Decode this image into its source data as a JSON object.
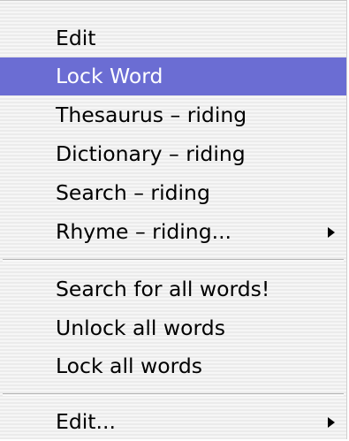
{
  "menu": {
    "group1": [
      {
        "label": "Edit",
        "selected": false,
        "submenu": false
      },
      {
        "label": "Lock Word",
        "selected": true,
        "submenu": false
      },
      {
        "label": "Thesaurus – riding",
        "selected": false,
        "submenu": false
      },
      {
        "label": "Dictionary – riding",
        "selected": false,
        "submenu": false
      },
      {
        "label": "Search – riding",
        "selected": false,
        "submenu": false
      },
      {
        "label": "Rhyme – riding...",
        "selected": false,
        "submenu": true
      }
    ],
    "group2": [
      {
        "label": "Search for all words!",
        "selected": false,
        "submenu": false
      },
      {
        "label": "Unlock all words",
        "selected": false,
        "submenu": false
      },
      {
        "label": "Lock all words",
        "selected": false,
        "submenu": false
      }
    ],
    "group3": [
      {
        "label": "Edit...",
        "selected": false,
        "submenu": true
      }
    ],
    "colors": {
      "highlight": "#6b6dd3",
      "highlight_text": "#ffffff",
      "text": "#000000",
      "background": "#f1f1f1"
    },
    "icons": {
      "submenu_arrow": "triangle-right-icon"
    }
  }
}
